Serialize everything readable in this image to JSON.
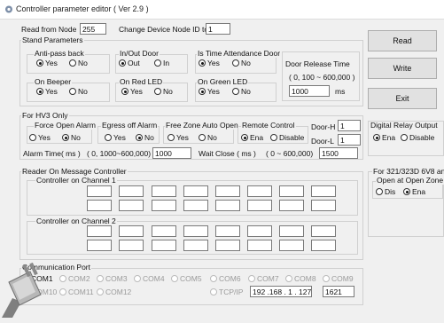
{
  "window": {
    "title": "Controller parameter editor ( Ver 2.9 )"
  },
  "top": {
    "read_from_node_label": "Read from Node",
    "read_from_node_value": "255",
    "change_node_label": "Change Device Node ID to",
    "change_node_value": "1"
  },
  "buttons": {
    "read": "Read",
    "write": "Write",
    "exit": "Exit"
  },
  "stand": {
    "title": "Stand Parameters",
    "anti_pass_back": "Anti-pass back",
    "in_out_door": "In/Out Door",
    "time_attendance_door": "Is Time Attendance Door",
    "door_release_time": "Door Release Time",
    "door_release_range": "( 0, 100 ~ 600,000 )",
    "door_release_value": "1000",
    "door_release_unit": "ms",
    "on_beeper": "On Beeper",
    "on_red_led": "On Red LED",
    "on_green_led": "On Green LED",
    "yes": "Yes",
    "no": "No",
    "out": "Out",
    "in": "In"
  },
  "hv3": {
    "title": "For HV3 Only",
    "force_open_alarm": "Force Open Alarm",
    "egress_off_alarm": "Egress off Alarm",
    "free_zone_auto_open": "Free Zone Auto Open",
    "remote_control": "Remote Control",
    "door_h": "Door-H",
    "door_h_value": "1",
    "door_l": "Door-L",
    "door_l_value": "1",
    "ena": "Ena",
    "disable": "Disable",
    "alarm_time_label": "Alarm Time( ms )",
    "alarm_time_range": "( 0, 1000~600,000)",
    "alarm_time_value": "1000",
    "wait_close_label": "Wait Close ( ms )",
    "wait_close_range": "( 0 ~ 600,000)",
    "wait_close_value": "1500"
  },
  "digital_relay": {
    "title": "Digital Relay Output",
    "ena": "Ena",
    "disable": "Disable"
  },
  "reader": {
    "title": "Reader On Message Controller",
    "channel1": "Controller on Channel 1",
    "channel2": "Controller on Channel 2"
  },
  "r321": {
    "title": "For 321/323D 6V8 and I",
    "open_at_open_zone": "Open at Open Zone",
    "dis": "Dis",
    "ena": "Ena"
  },
  "comm": {
    "title": "Communication Port",
    "ports_row1": [
      "COM1",
      "COM2",
      "COM3",
      "COM4",
      "COM5",
      "COM6",
      "COM7",
      "COM8",
      "COM9"
    ],
    "ports_row2": [
      "COM10",
      "COM11",
      "COM12"
    ],
    "tcpip": "TCP/IP",
    "ip": "192 .168 . 1  . 127",
    "port": "1621"
  }
}
